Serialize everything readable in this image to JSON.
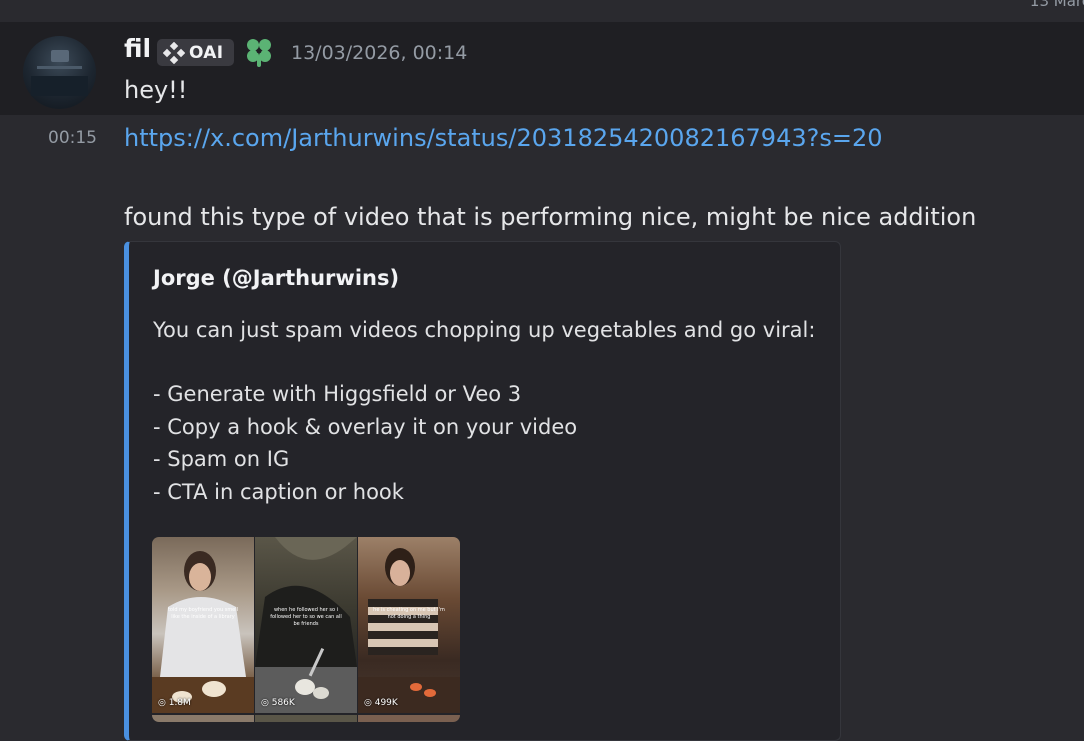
{
  "date_divider": "13 Marc",
  "message": {
    "username": "fil",
    "tag": "OAI",
    "timestamp": "13/03/2026, 00:14",
    "text": "hey!!"
  },
  "followup": {
    "time": "00:15",
    "link": "https://x.com/Jarthurwins/status/2031825420082167943?s=20",
    "text": "found this type of video that is performing nice, might be nice addition"
  },
  "embed": {
    "author": "Jorge (@Jarthurwins)",
    "lines": [
      "You can just spam videos chopping up vegetables and go viral:",
      "- Generate with Higgsfield or Veo 3",
      "- Copy a hook & overlay it on your video",
      "- Spam on IG",
      "- CTA in caption or hook"
    ],
    "thumbnails": [
      {
        "views": "1.8M",
        "caption": "told my boyfriend you smell like the inside of a library"
      },
      {
        "views": "586K",
        "caption": "when he followed her so i followed her to so we can all be friends"
      },
      {
        "views": "499K",
        "caption": "he is cheating on me but i'm not doing a thing"
      }
    ]
  },
  "colors": {
    "background": "#2a2a2f",
    "hover": "#1f1f23",
    "link": "#5aa6ee",
    "embed_accent": "#4a90e0"
  }
}
